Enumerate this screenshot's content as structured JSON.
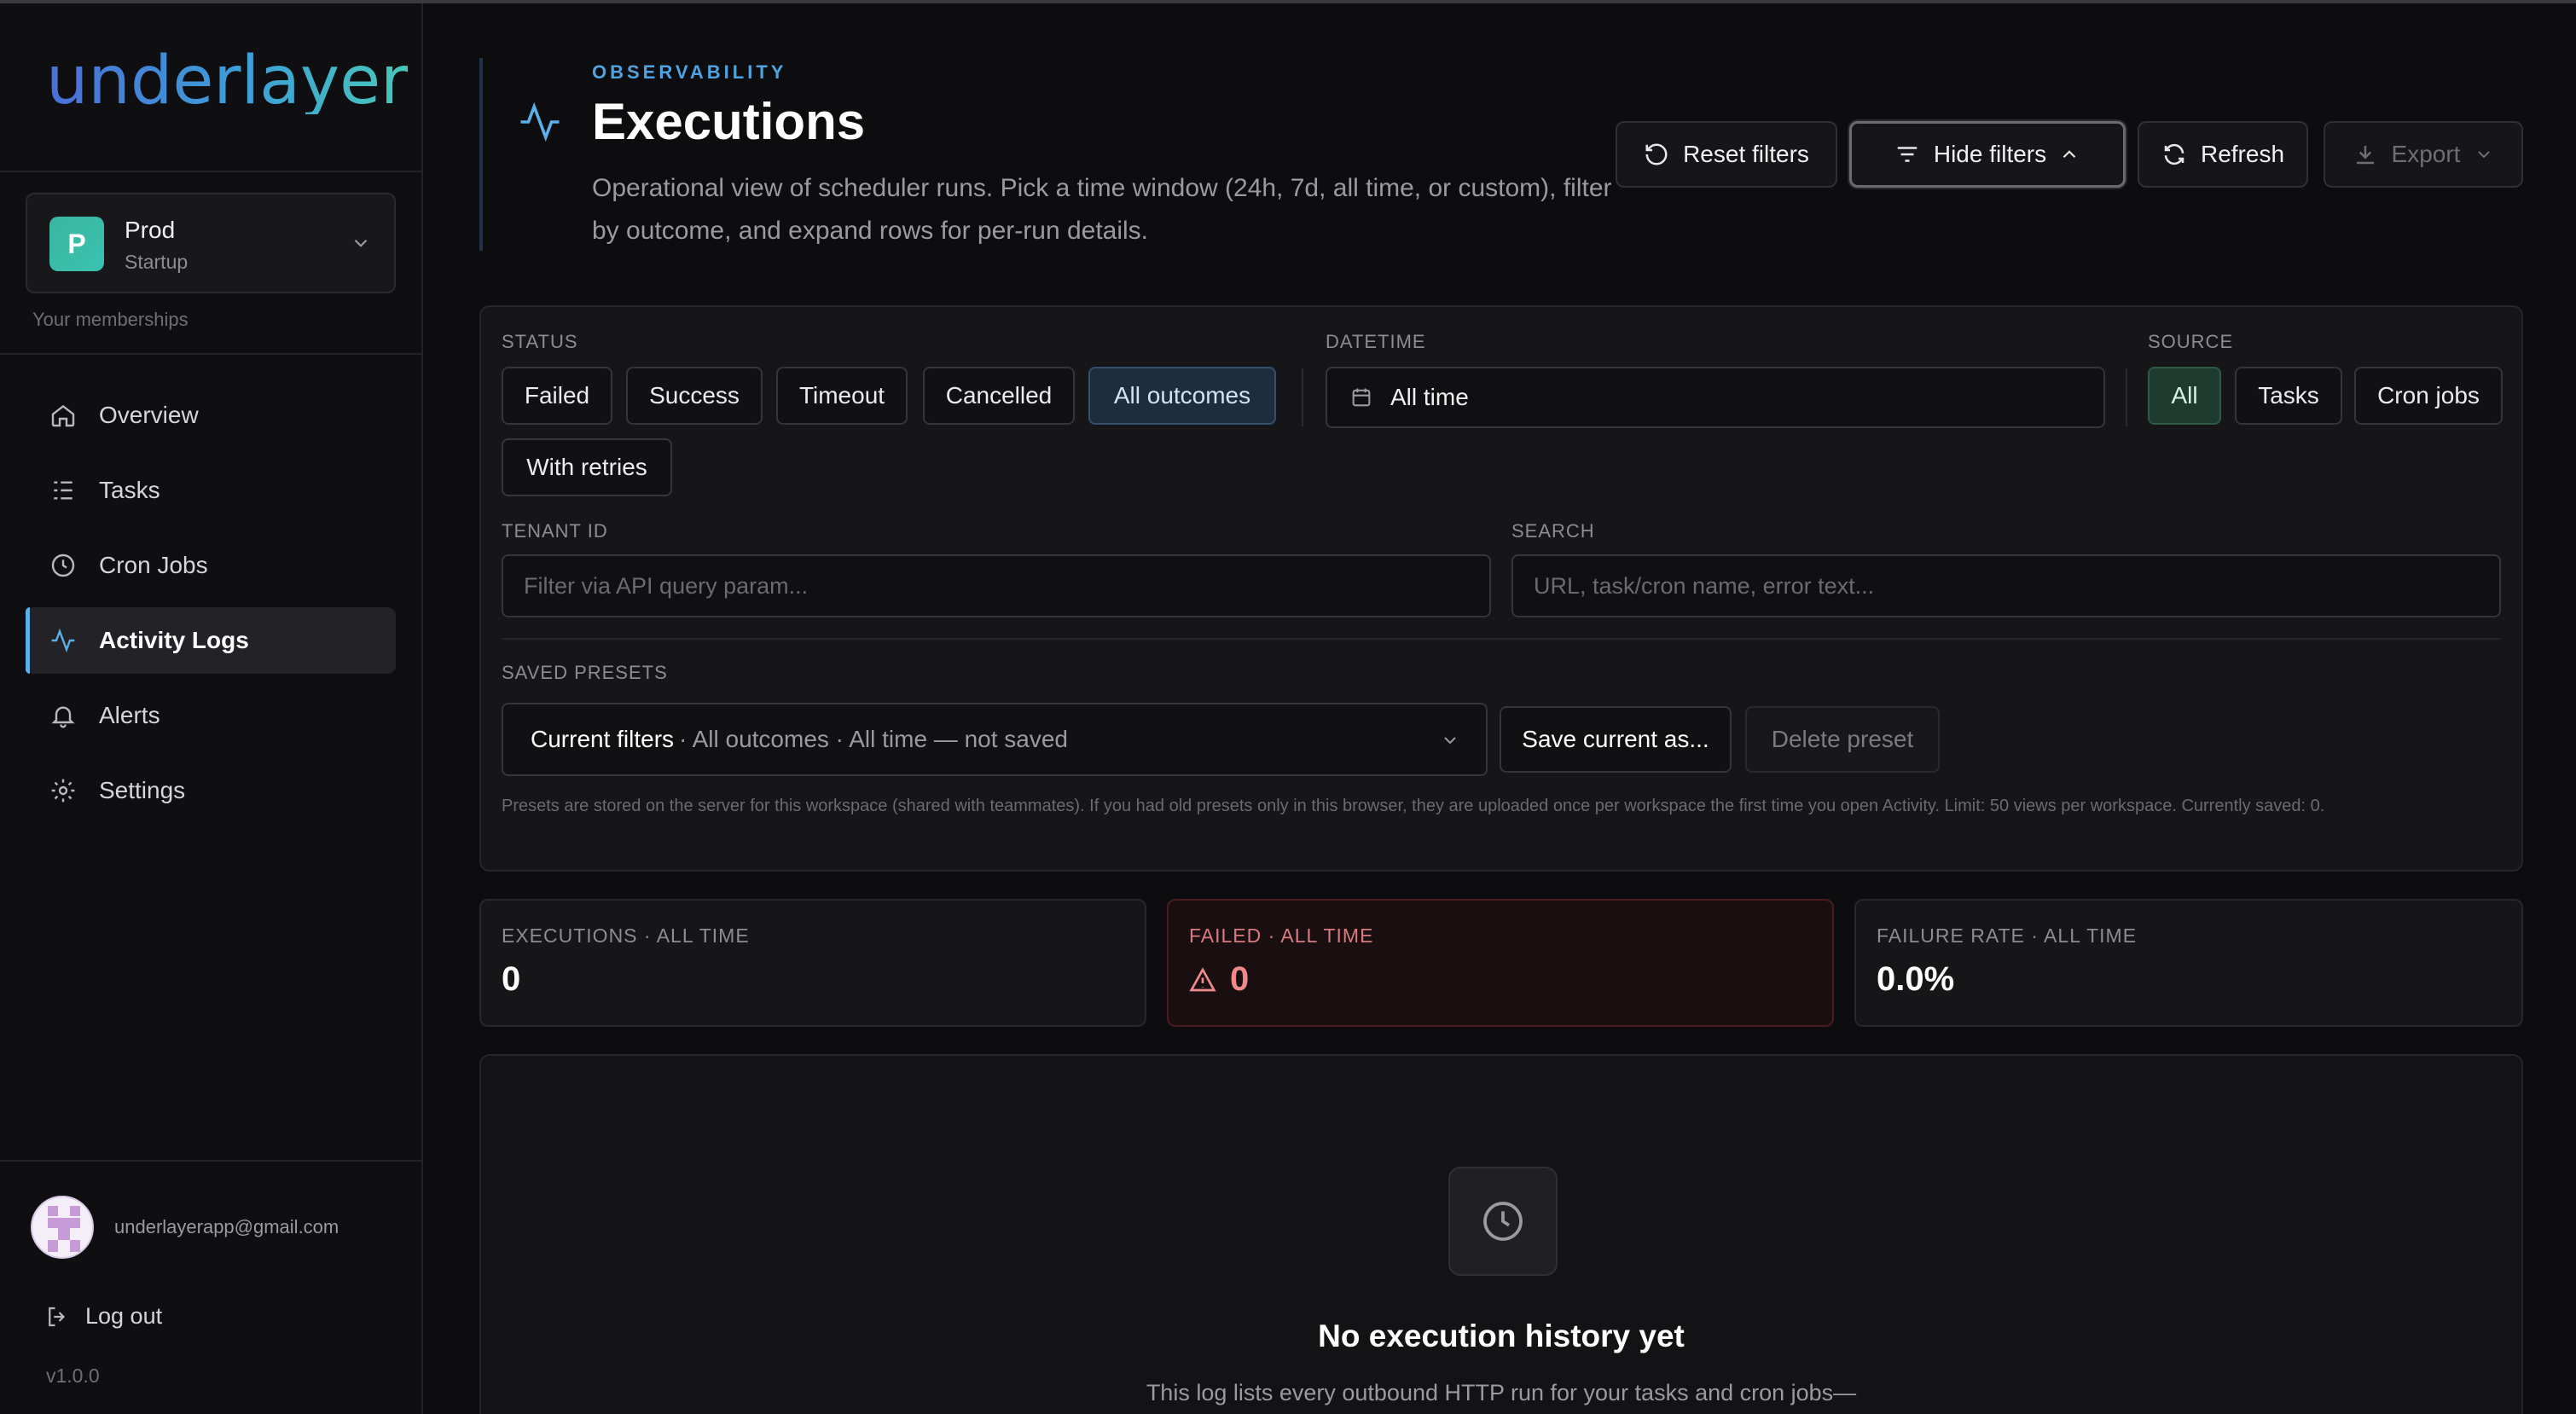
{
  "app": {
    "brand": "underlayer",
    "version": "v1.0.0"
  },
  "org": {
    "initial": "P",
    "name": "Prod",
    "plan": "Startup",
    "memberships_label": "Your memberships"
  },
  "nav": {
    "items": [
      {
        "label": "Overview",
        "icon": "home-icon"
      },
      {
        "label": "Tasks",
        "icon": "task-list-icon"
      },
      {
        "label": "Cron Jobs",
        "icon": "clock-icon"
      },
      {
        "label": "Activity Logs",
        "icon": "activity-icon",
        "active": true
      },
      {
        "label": "Alerts",
        "icon": "bell-icon"
      },
      {
        "label": "Settings",
        "icon": "gear-icon"
      }
    ]
  },
  "user": {
    "email": "underlayerapp@gmail.com",
    "logout_label": "Log out"
  },
  "header": {
    "eyebrow": "OBSERVABILITY",
    "title": "Executions",
    "description": "Operational view of scheduler runs. Pick a time window (24h, 7d, all time, or custom), filter by outcome, and expand rows for per-run details.",
    "buttons": {
      "reset": "Reset filters",
      "hide": "Hide filters",
      "refresh": "Refresh",
      "export": "Export"
    }
  },
  "filters": {
    "status_label": "STATUS",
    "status_options": [
      "Failed",
      "Success",
      "Timeout",
      "Cancelled",
      "All outcomes",
      "With retries"
    ],
    "status_selected": "All outcomes",
    "datetime_label": "DATETIME",
    "datetime_value": "All time",
    "source_label": "SOURCE",
    "source_options": [
      "All",
      "Tasks",
      "Cron jobs"
    ],
    "source_selected": "All",
    "tenant_label": "TENANT ID",
    "tenant_placeholder": "Filter via API query param...",
    "search_label": "SEARCH",
    "search_placeholder": "URL, task/cron name, error text...",
    "presets_label": "SAVED PRESETS",
    "preset_current": "Current filters",
    "preset_summary": "· All outcomes · All time — not saved",
    "save_label": "Save current as...",
    "delete_label": "Delete preset",
    "preset_note": "Presets are stored on the server for this workspace (shared with teammates). If you had old presets only in this browser, they are uploaded once per workspace the first time you open Activity. Limit: 50 views per workspace. Currently saved: 0."
  },
  "stats": [
    {
      "label": "EXECUTIONS · ALL TIME",
      "value": "0"
    },
    {
      "label": "FAILED · ALL TIME",
      "value": "0",
      "tone": "danger"
    },
    {
      "label": "FAILURE RATE · ALL TIME",
      "value": "0.0%"
    }
  ],
  "empty": {
    "title": "No execution history yet",
    "description": "This log lists every outbound HTTP run for your tasks and cron jobs—"
  },
  "colors": {
    "accent": "#4fa3e0",
    "danger": "#f08a8a",
    "success_chip": "#1f3a2e",
    "selected_chip": "#1d2d3e"
  }
}
